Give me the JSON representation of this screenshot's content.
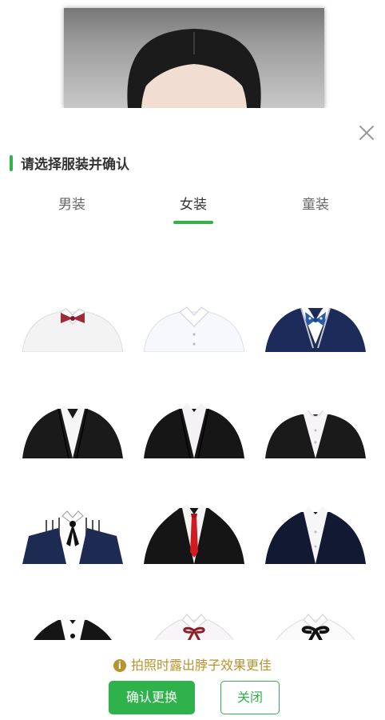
{
  "header": {
    "title": "请选择服装并确认"
  },
  "tabs": [
    {
      "label": "男装",
      "active": false
    },
    {
      "label": "女装",
      "active": true
    },
    {
      "label": "童装",
      "active": false
    }
  ],
  "clothes": [
    {
      "id": "c1",
      "name": "white-shirt-red-bowtie"
    },
    {
      "id": "c2",
      "name": "white-shirt-plain"
    },
    {
      "id": "c3",
      "name": "navy-blazer-blue-bowtie"
    },
    {
      "id": "c4",
      "name": "black-suit-open-collar"
    },
    {
      "id": "c5",
      "name": "black-suit-white-shirt"
    },
    {
      "id": "c6",
      "name": "black-suit-rounded-collar"
    },
    {
      "id": "c7",
      "name": "striped-shirt-black-bow"
    },
    {
      "id": "c8",
      "name": "black-suit-red-tie"
    },
    {
      "id": "c9",
      "name": "navy-suit-white-shirt"
    },
    {
      "id": "c10",
      "name": "black-suit-dark-button"
    },
    {
      "id": "c11",
      "name": "white-blouse-red-bow"
    },
    {
      "id": "c12",
      "name": "white-blouse-black-bow"
    }
  ],
  "hint": {
    "icon": "info-icon",
    "text": "拍照时露出脖子效果更佳"
  },
  "buttons": {
    "confirm": "确认更换",
    "close": "关闭"
  },
  "colors": {
    "accent": "#33b24a",
    "hint": "#b9922c"
  }
}
